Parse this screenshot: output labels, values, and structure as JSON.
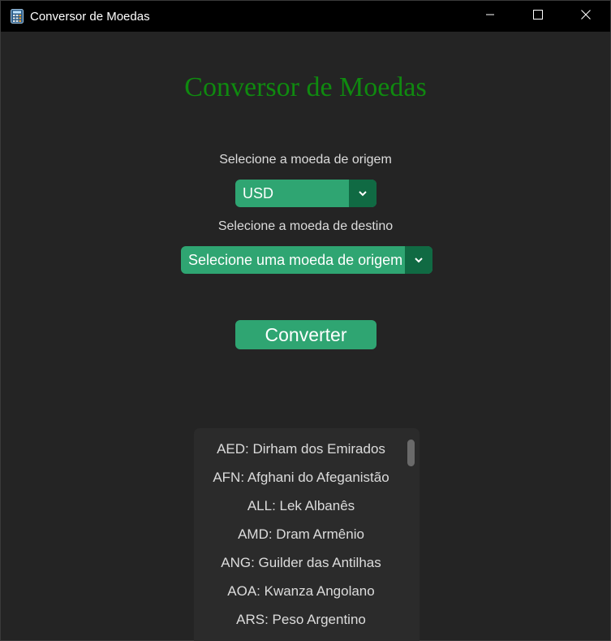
{
  "window": {
    "title": "Conversor de Moedas",
    "icon": "calculator-icon",
    "controls": [
      "minimize-icon",
      "maximize-icon",
      "close-icon"
    ]
  },
  "main": {
    "heading": "Conversor de Moedas",
    "origin_label": "Selecione a moeda de origem",
    "origin_value": "USD",
    "dest_label": "Selecione a moeda de destino",
    "dest_value": "Selecione uma moeda de origem",
    "convert_label": "Converter"
  },
  "currency_list": {
    "items": [
      "AED: Dirham dos Emirados",
      "AFN: Afghani do Afeganistão",
      "ALL: Lek Albanês",
      "AMD: Dram Armênio",
      "ANG: Guilder das Antilhas",
      "AOA: Kwanza Angolano",
      "ARS: Peso Argentino"
    ]
  },
  "colors": {
    "background": "#242424",
    "titlebar": "#000000",
    "heading": "#0f8a0f",
    "accent": "#2fa572",
    "accent_dark": "#106a43",
    "list_bg": "#2b2b2b",
    "text": "#dcdcdc"
  }
}
